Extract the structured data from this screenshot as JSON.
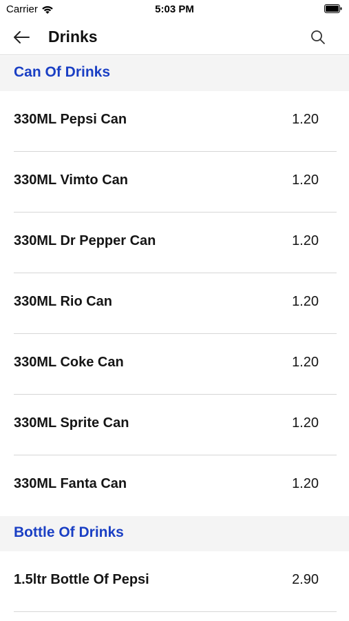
{
  "status_bar": {
    "carrier": "Carrier",
    "time": "5:03 PM"
  },
  "nav": {
    "title": "Drinks",
    "back_icon": "arrow-left-icon",
    "search_icon": "search-icon"
  },
  "colors": {
    "section_title": "#1a3fc4",
    "section_background": "#f4f4f4",
    "divider": "#d6d6d6"
  },
  "sections": [
    {
      "title": "Can Of Drinks",
      "items": [
        {
          "name": "330ML Pepsi Can",
          "price": "1.20"
        },
        {
          "name": "330ML Vimto Can",
          "price": "1.20"
        },
        {
          "name": "330ML Dr Pepper Can",
          "price": "1.20"
        },
        {
          "name": "330ML Rio Can",
          "price": "1.20"
        },
        {
          "name": "330ML Coke Can",
          "price": "1.20"
        },
        {
          "name": "330ML Sprite Can",
          "price": "1.20"
        },
        {
          "name": "330ML Fanta Can",
          "price": "1.20"
        }
      ]
    },
    {
      "title": "Bottle Of Drinks",
      "items": [
        {
          "name": "1.5ltr Bottle Of Pepsi",
          "price": "2.90"
        }
      ]
    }
  ]
}
